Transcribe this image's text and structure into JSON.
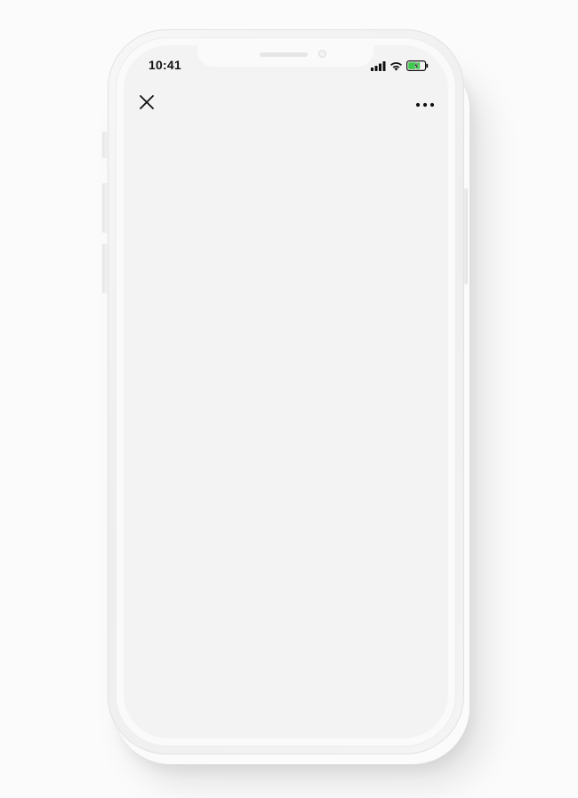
{
  "status_bar": {
    "time": "10:41",
    "icons": [
      "signal-icon",
      "wifi-icon",
      "battery-charging-icon"
    ],
    "battery_color": "#3cc84a"
  },
  "nav_bar": {
    "left_icon": "close-icon",
    "right_icon": "more-horizontal-icon"
  },
  "colors": {
    "screen_background": "#f3f3f3",
    "phone_body": "#f4f4f4",
    "icon_color": "#111111"
  }
}
